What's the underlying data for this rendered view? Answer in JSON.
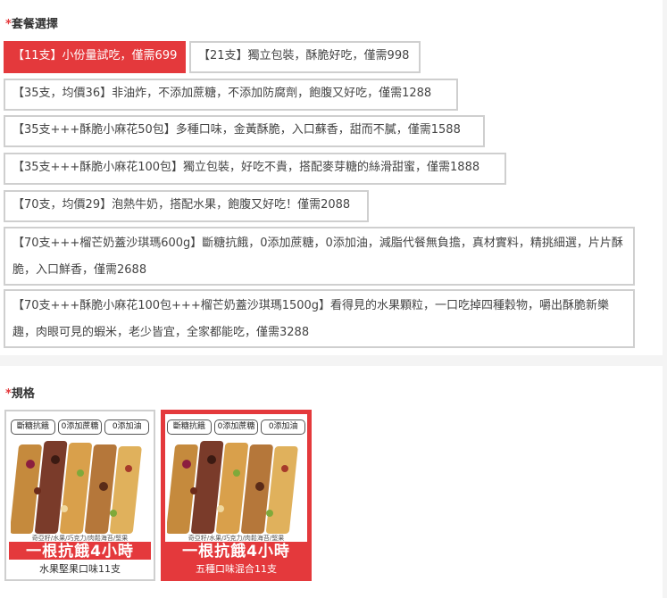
{
  "package": {
    "required_mark": "*",
    "title": "套餐選擇",
    "options": [
      {
        "label": "【11支】小份量試吃，僅需699",
        "selected": true
      },
      {
        "label": "【21支】獨立包裝，酥脆好吃，僅需998",
        "selected": false
      },
      {
        "label": "【35支，均價36】非油炸，不添加蔗糖，不添加防腐劑，飽腹又好吃，僅需1288",
        "selected": false
      },
      {
        "label": "【35支+++酥脆小麻花50包】多種口味，金黃酥脆，入口蘇香，甜而不膩，僅需1588",
        "selected": false
      },
      {
        "label": "【35支+++酥脆小麻花100包】獨立包裝，好吃不貴，搭配麥芽糖的絲滑甜蜜，僅需1888",
        "selected": false
      },
      {
        "label": "【70支，均價29】泡熱牛奶，搭配水果，飽腹又好吃！僅需2088",
        "selected": false
      },
      {
        "label": "【70支+++榴芒奶蓋沙琪瑪600g】斷糖抗餓，0添加蔗糖，0添加油，減脂代餐無負擔，真材實料，精挑細選，片片酥脆，入口鮮香，僅需2688",
        "selected": false
      },
      {
        "label": "【70支+++酥脆小麻花100包+++榴芒奶蓋沙琪瑪1500g】看得見的水果顆粒，一口吃掉四種穀物，嚼出酥脆新樂趣，肉眼可見的蝦米，老少皆宜，全家都能吃，僅需3288",
        "selected": false
      }
    ]
  },
  "spec": {
    "required_mark": "*",
    "title": "規格",
    "cards": [
      {
        "name": "水果堅果口味11支",
        "selected": false,
        "badges": [
          "斷糖抗餓",
          "0添加蔗糖",
          "0添加油"
        ],
        "ingredients": "奇亞籽/水果/巧克力/肉鬆海苔/堅果",
        "slogan": "一根抗餓4小時"
      },
      {
        "name": "五種口味混合11支",
        "selected": true,
        "badges": [
          "斷糖抗餓",
          "0添加蔗糖",
          "0添加油"
        ],
        "ingredients": "奇亞籽/水果/巧克力/肉鬆海苔/堅果",
        "slogan": "一根抗餓4小時"
      }
    ]
  },
  "colors": {
    "accent": "#e4393c",
    "border": "#cfcfcf",
    "page_bg": "#f4f4f4"
  }
}
